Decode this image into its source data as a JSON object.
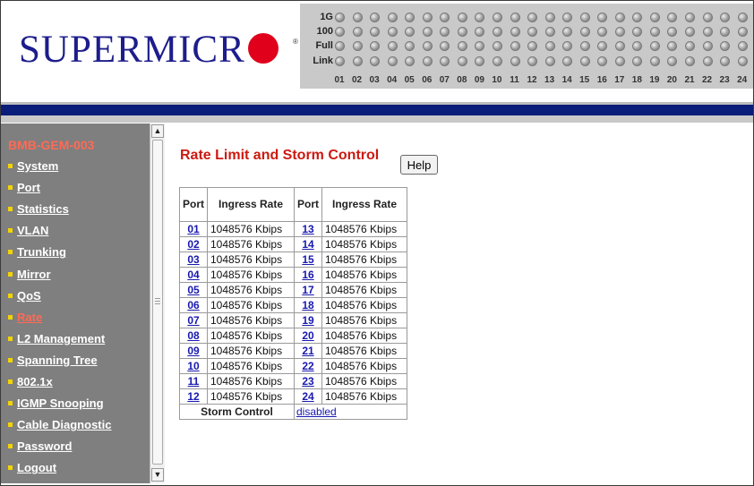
{
  "brand": {
    "logo_text": "SUPERMICR",
    "reg_mark": "®"
  },
  "leds": {
    "row_labels": [
      "1G",
      "100",
      "Full",
      "Link"
    ],
    "ports": [
      "01",
      "02",
      "03",
      "04",
      "05",
      "06",
      "07",
      "08",
      "09",
      "10",
      "11",
      "12",
      "13",
      "14",
      "15",
      "16",
      "17",
      "18",
      "19",
      "20",
      "21",
      "22",
      "23",
      "24"
    ]
  },
  "sidebar": {
    "hostname": "BMB-GEM-003",
    "items": [
      {
        "label": "System",
        "active": false
      },
      {
        "label": "Port",
        "active": false
      },
      {
        "label": "Statistics",
        "active": false
      },
      {
        "label": "VLAN",
        "active": false
      },
      {
        "label": "Trunking",
        "active": false
      },
      {
        "label": "Mirror",
        "active": false
      },
      {
        "label": "QoS",
        "active": false
      },
      {
        "label": "Rate",
        "active": true
      },
      {
        "label": "L2 Management",
        "active": false
      },
      {
        "label": "Spanning Tree",
        "active": false
      },
      {
        "label": "802.1x",
        "active": false
      },
      {
        "label": "IGMP Snooping",
        "active": false
      },
      {
        "label": "Cable Diagnostic",
        "active": false
      },
      {
        "label": "Password",
        "active": false
      },
      {
        "label": "Logout",
        "active": false
      }
    ]
  },
  "main": {
    "title": "Rate Limit and Storm Control",
    "help_label": "Help",
    "table": {
      "col_port": "Port",
      "col_rate": "Ingress Rate",
      "rows": [
        {
          "p1": "01",
          "r1": "1048576 Kbips",
          "p2": "13",
          "r2": "1048576 Kbips"
        },
        {
          "p1": "02",
          "r1": "1048576 Kbips",
          "p2": "14",
          "r2": "1048576 Kbips"
        },
        {
          "p1": "03",
          "r1": "1048576 Kbips",
          "p2": "15",
          "r2": "1048576 Kbips"
        },
        {
          "p1": "04",
          "r1": "1048576 Kbips",
          "p2": "16",
          "r2": "1048576 Kbips"
        },
        {
          "p1": "05",
          "r1": "1048576 Kbips",
          "p2": "17",
          "r2": "1048576 Kbips"
        },
        {
          "p1": "06",
          "r1": "1048576 Kbips",
          "p2": "18",
          "r2": "1048576 Kbips"
        },
        {
          "p1": "07",
          "r1": "1048576 Kbips",
          "p2": "19",
          "r2": "1048576 Kbips"
        },
        {
          "p1": "08",
          "r1": "1048576 Kbips",
          "p2": "20",
          "r2": "1048576 Kbips"
        },
        {
          "p1": "09",
          "r1": "1048576 Kbips",
          "p2": "21",
          "r2": "1048576 Kbips"
        },
        {
          "p1": "10",
          "r1": "1048576 Kbips",
          "p2": "22",
          "r2": "1048576 Kbips"
        },
        {
          "p1": "11",
          "r1": "1048576 Kbips",
          "p2": "23",
          "r2": "1048576 Kbips"
        },
        {
          "p1": "12",
          "r1": "1048576 Kbips",
          "p2": "24",
          "r2": "1048576 Kbips"
        }
      ],
      "storm_label": "Storm Control",
      "storm_value": "disabled"
    }
  },
  "colors": {
    "brand_blue": "#1d1d8c",
    "logo_red": "#e0001b",
    "header_bar": "#0a1d79",
    "sidebar_bg": "#7f7f7f",
    "active_item": "#ff6a55",
    "title_red": "#cc1a10",
    "link_blue": "#1818b0"
  }
}
